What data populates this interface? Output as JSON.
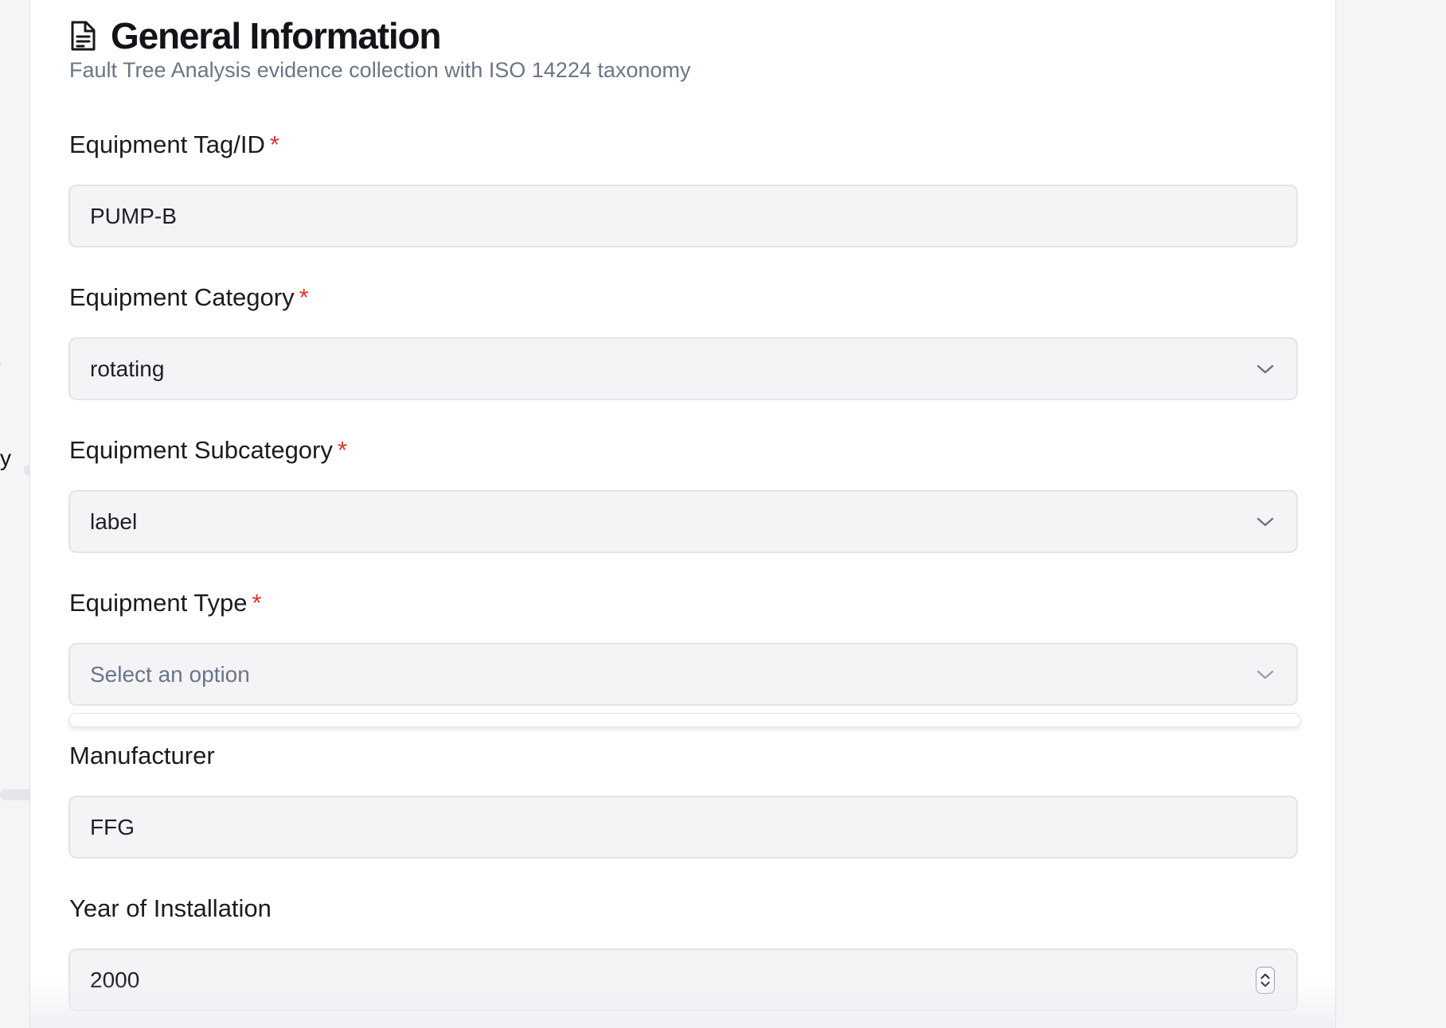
{
  "form": {
    "title": "General Information",
    "subtitle": "Fault Tree Analysis evidence collection with ISO 14224 taxonomy",
    "required_marker": "*",
    "fields": {
      "tag": {
        "label": "Equipment Tag/ID",
        "value": "PUMP-B"
      },
      "category": {
        "label": "Equipment Category",
        "value": "rotating"
      },
      "subcategory": {
        "label": "Equipment Subcategory",
        "value": "label"
      },
      "type": {
        "label": "Equipment Type",
        "placeholder": "Select an option"
      },
      "manufacturer": {
        "label": "Manufacturer",
        "value": "FFG"
      },
      "year": {
        "label": "Year of Installation",
        "value": "2000"
      }
    }
  },
  "background_app": {
    "clipped_text": "y"
  },
  "icons": {
    "header": "document-icon",
    "select": "chevron-down-icon",
    "stepper": "number-stepper-icon",
    "background_nav": "chevron-right-icon"
  },
  "colors": {
    "required": "#e0342b",
    "subtitle": "#6c7586",
    "field_bg": "#f4f4f7",
    "field_border": "#e3e3e8"
  }
}
